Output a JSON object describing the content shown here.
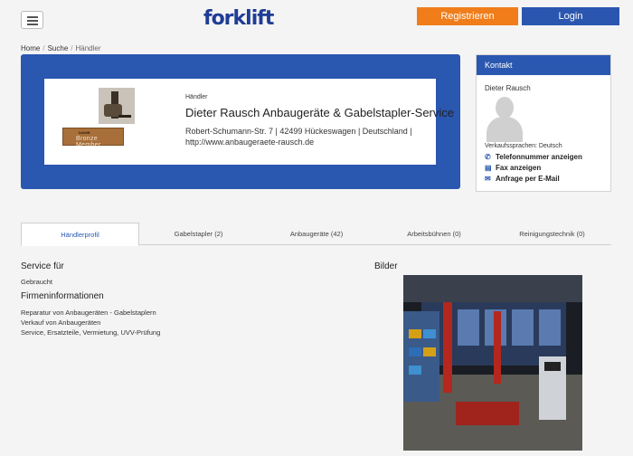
{
  "header": {
    "logo_text": "forklift",
    "register_label": "Registrieren",
    "login_label": "Login"
  },
  "breadcrumb": [
    "Home",
    "Suche",
    "Händler"
  ],
  "dealer": {
    "type_label": "Händler",
    "name": "Dieter Rausch Anbaugeräte & Gabelstapler-Service",
    "address": "Robert-Schumann-Str. 7 | 42499 Hückeswagen | Deutschland |",
    "website": "http://www.anbaugeraete-rausch.de",
    "badge_top": "forklift",
    "badge_label": "Bronze Member"
  },
  "contact": {
    "title": "Kontakt",
    "person": "Dieter Rausch",
    "languages": "Verkaufssprachen: Deutsch",
    "phone_label": "Telefonnummer anzeigen",
    "fax_label": "Fax anzeigen",
    "email_label": "Anfrage per E-Mail"
  },
  "tabs": [
    {
      "label": "Händlerprofil",
      "active": true
    },
    {
      "label": "Gabelstapler (2)",
      "active": false
    },
    {
      "label": "Anbaugeräte (42)",
      "active": false
    },
    {
      "label": "Arbeitsbühnen (0)",
      "active": false
    },
    {
      "label": "Reinigungstechnik (0)",
      "active": false
    }
  ],
  "profile": {
    "service_title": "Service für",
    "service_value": "Gebraucht",
    "company_title": "Firmeninformationen",
    "company_lines": [
      "Reparatur von Anbaugeräten - Gabelstaplern",
      "Verkauf von Anbaugeräten",
      "Service, Ersatzteile, Vermietung, UVV-Prüfung"
    ],
    "images_title": "Bilder"
  },
  "colors": {
    "brand_blue": "#2a57b0",
    "accent_orange": "#f07d1a"
  }
}
